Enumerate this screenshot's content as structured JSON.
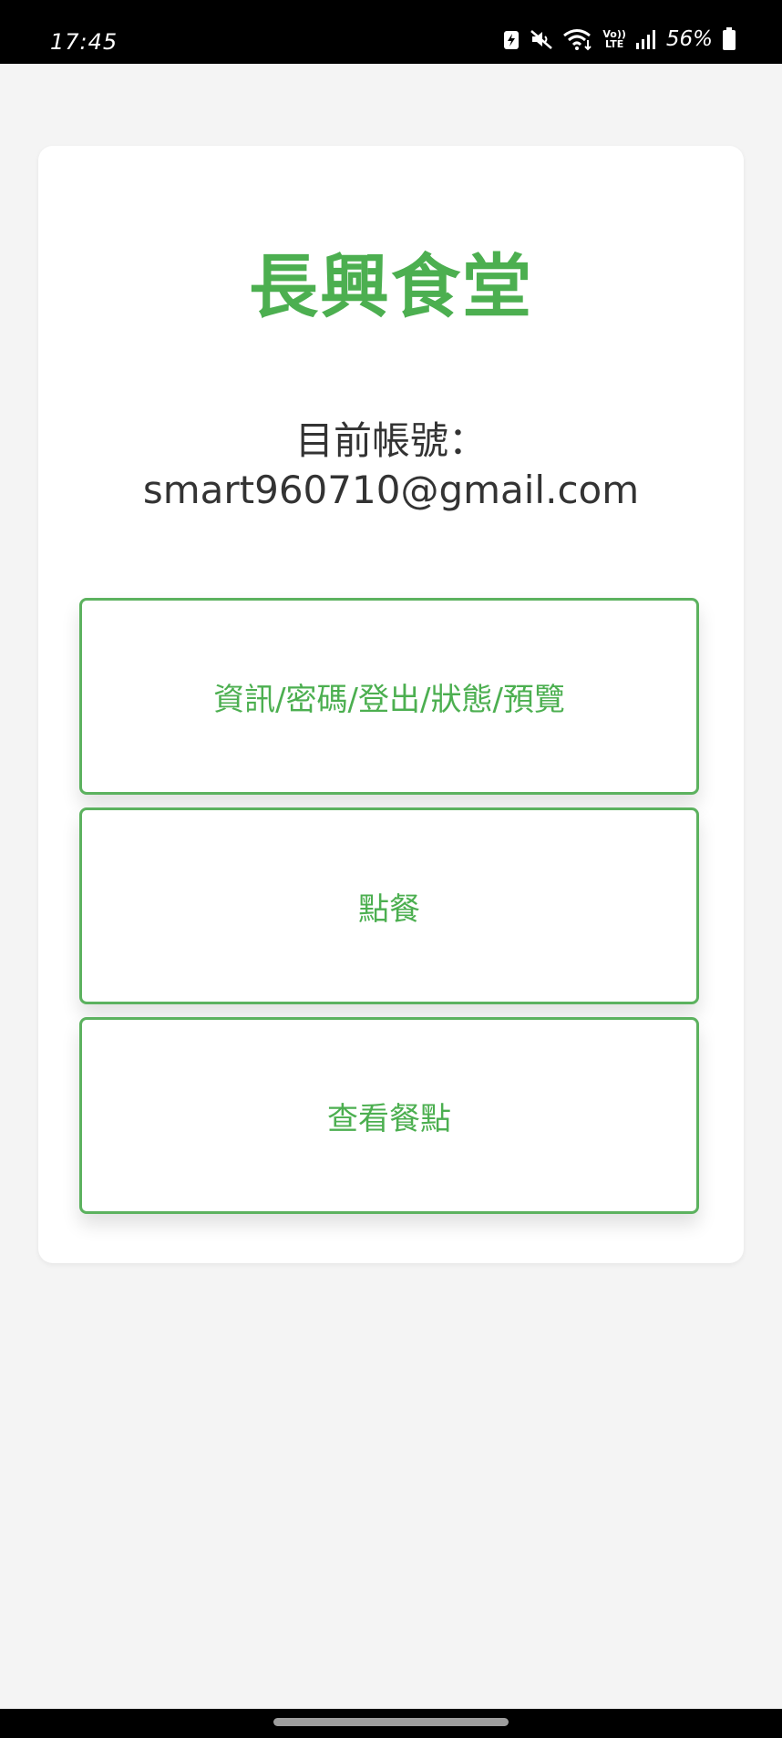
{
  "status_bar": {
    "time": "17:45",
    "lte_top": "Vo))",
    "lte_bottom": "LTE",
    "battery_percent": "56%",
    "icons": [
      "battery-saver-icon",
      "mute-icon",
      "wifi-icon",
      "volte-icon",
      "signal-icon",
      "battery-icon"
    ]
  },
  "app": {
    "title": "長興食堂",
    "account_label": "目前帳號：",
    "account_email": "smart960710@gmail.com",
    "accent_color": "#4caf50"
  },
  "menu": {
    "buttons": [
      {
        "label": "資訊/密碼/登出/狀態/預覽"
      },
      {
        "label": "點餐"
      },
      {
        "label": "查看餐點"
      }
    ]
  }
}
